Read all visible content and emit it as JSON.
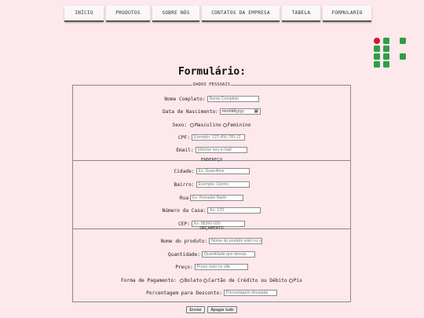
{
  "nav": {
    "items": [
      {
        "label": "INÍCIO"
      },
      {
        "label": "PRODUTOS"
      },
      {
        "label": "SOBRE NÓS"
      },
      {
        "label": "CONTATOS DA EMPRESA"
      },
      {
        "label": "TABELA"
      },
      {
        "label": "FORMULARIO"
      }
    ]
  },
  "page": {
    "title": "Formulário:"
  },
  "dados_pessoais": {
    "legend": "DADOS PESSOAIS",
    "nome_label": "Nome Completo:",
    "nome_placeholder": "Nome Completo",
    "nascimento_label": "Data de Nascimento:",
    "nascimento_value": "mm/dd/yyyy",
    "sexo_label": "Sexo:",
    "sexo_options": [
      "Masculino",
      "Feminino"
    ],
    "cpf_label": "CPF:",
    "cpf_placeholder": "Exemplo: 123.456.789-12",
    "email_label": "Email:",
    "email_placeholder": "Informe seu e-mail"
  },
  "endereco": {
    "legend": "ENDEREÇO",
    "cidade_label": "Cidade:",
    "cidade_placeholder": "Ex: Guarulhos",
    "bairro_label": "Bairro:",
    "bairro_placeholder": "Exemplo: Centro",
    "rua_label": "Rua",
    "rua_placeholder": "Ex: Reinaldo Barth",
    "numero_label": "Número da Casa:",
    "numero_placeholder": "Ex: 123",
    "cep_label": "CEP:",
    "cep_placeholder": "Ex: 88360-000"
  },
  "orcamento": {
    "legend": "ORÇAMENTO",
    "produto_label": "Nome do produto:",
    "produto_placeholder": "Nome do produto visto no site",
    "quantidade_label": "Quantidade:",
    "quantidade_placeholder": "Quantidade que deseja",
    "preco_label": "Preço:",
    "preco_placeholder": "Preço visto no site",
    "pagamento_label": "Forma de Pagamento:",
    "pagamento_options": [
      "Boleto",
      "Cartão de Crédito ou Débito",
      "Pix"
    ],
    "desconto_label": "Porcentagem para Desconto:",
    "desconto_placeholder": "Porcentagem desejada"
  },
  "buttons": {
    "enviar": "Enviar",
    "apagar": "Apagar tudo"
  },
  "colors": {
    "background": "#fde8ec",
    "logo_green": "#2f9e44",
    "logo_red": "#d1192b"
  }
}
